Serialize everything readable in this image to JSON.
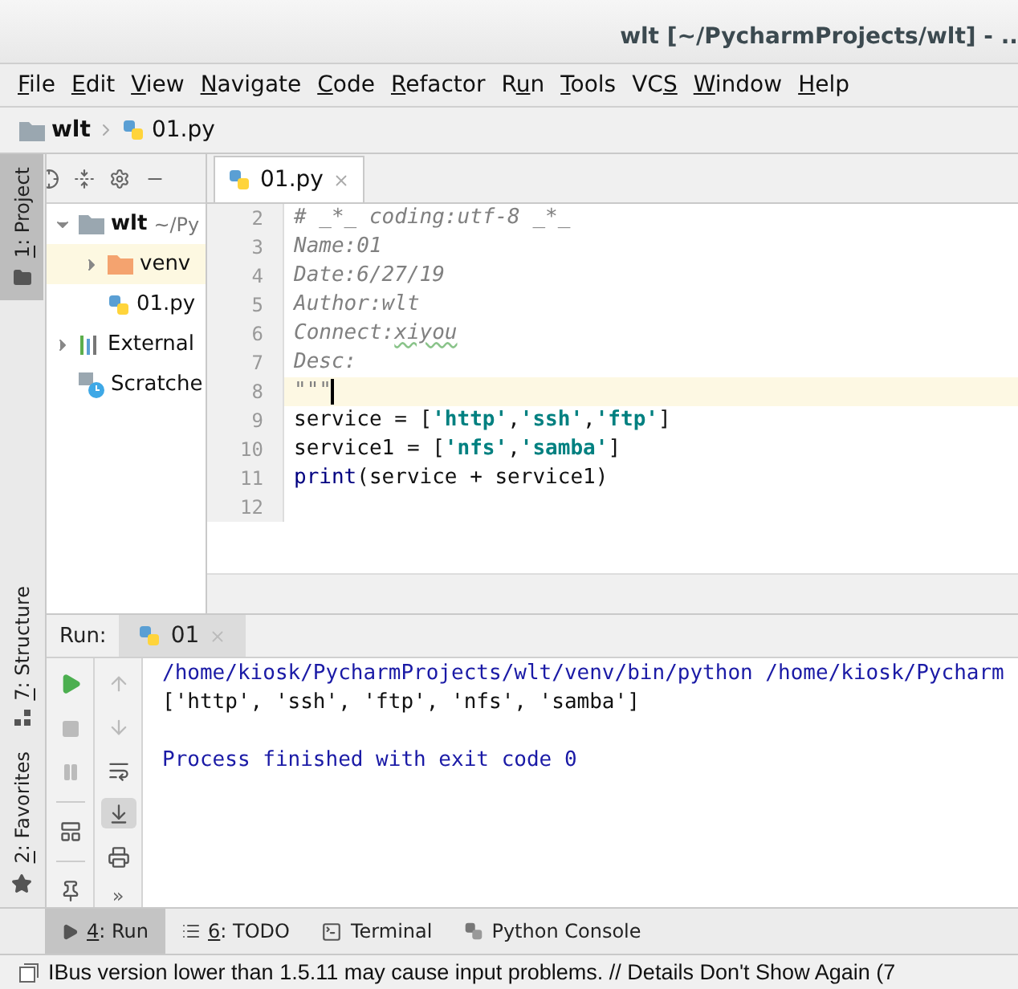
{
  "window": {
    "title": "wlt [~/PycharmProjects/wlt] - .."
  },
  "menu": [
    {
      "key": "F",
      "post": "ile"
    },
    {
      "key": "E",
      "post": "dit"
    },
    {
      "key": "V",
      "post": "iew"
    },
    {
      "key": "N",
      "post": "avigate"
    },
    {
      "key": "C",
      "post": "ode"
    },
    {
      "key": "R",
      "post": "efactor"
    },
    {
      "pre": "R",
      "key": "u",
      "post": "n"
    },
    {
      "key": "T",
      "post": "ools"
    },
    {
      "pre": "VC",
      "key": "S"
    },
    {
      "key": "W",
      "post": "indow"
    },
    {
      "key": "H",
      "post": "elp"
    }
  ],
  "breadcrumb": [
    {
      "kind": "folder",
      "label": "wlt"
    },
    {
      "kind": "python",
      "label": "01.py"
    }
  ],
  "left_tool_tabs": [
    {
      "key": "1",
      "post": ": Project",
      "selected": true,
      "kind": "folder"
    },
    {
      "key": "7",
      "post": ": Structure",
      "selected": false,
      "kind": "structure"
    },
    {
      "key": "2",
      "post": ": Favorites",
      "selected": false,
      "kind": "star"
    }
  ],
  "project_tree": [
    {
      "kind": "folder",
      "label": "wlt",
      "path": "~/Py",
      "expanded": true,
      "selected": false,
      "children": [
        {
          "kind": "venv",
          "label": "venv",
          "expanded": false,
          "selected": true
        },
        {
          "kind": "python",
          "label": "01.py",
          "selected": false
        }
      ]
    },
    {
      "kind": "library",
      "label": "External",
      "expanded": false,
      "selected": false
    },
    {
      "kind": "scratches",
      "label": "Scratche",
      "selected": false
    }
  ],
  "editor_tabs": [
    {
      "label": "01.py",
      "selected": true
    }
  ],
  "code_lines": [
    {
      "number": "2",
      "current": false,
      "tokens": [
        {
          "kind": "comment",
          "text": "# _*_ coding:utf-8 _*_"
        }
      ]
    },
    {
      "number": "3",
      "current": false,
      "tokens": [
        {
          "kind": "comment",
          "text": "Name:01"
        }
      ]
    },
    {
      "number": "4",
      "current": false,
      "tokens": [
        {
          "kind": "comment",
          "text": "Date:6/27/19"
        }
      ]
    },
    {
      "number": "5",
      "current": false,
      "tokens": [
        {
          "kind": "comment",
          "text": "Author:wlt"
        }
      ]
    },
    {
      "number": "6",
      "current": false,
      "tokens": [
        {
          "kind": "comment",
          "text": "Connect:"
        },
        {
          "kind": "typo",
          "text": "xiyou"
        }
      ]
    },
    {
      "number": "7",
      "current": false,
      "tokens": [
        {
          "kind": "comment",
          "text": "Desc:"
        }
      ]
    },
    {
      "number": "8",
      "current": true,
      "tokens": [
        {
          "kind": "comment",
          "text": "\"\"\""
        }
      ]
    },
    {
      "number": "9",
      "current": false,
      "tokens": [
        {
          "kind": "plain",
          "text": "service = ["
        },
        {
          "kind": "string",
          "text": "'http'"
        },
        {
          "kind": "plain",
          "text": ","
        },
        {
          "kind": "string",
          "text": "'ssh'"
        },
        {
          "kind": "plain",
          "text": ","
        },
        {
          "kind": "string",
          "text": "'ftp'"
        },
        {
          "kind": "plain",
          "text": "]"
        }
      ]
    },
    {
      "number": "10",
      "current": false,
      "tokens": [
        {
          "kind": "plain",
          "text": "service1 = ["
        },
        {
          "kind": "string",
          "text": "'nfs'"
        },
        {
          "kind": "plain",
          "text": ","
        },
        {
          "kind": "string",
          "text": "'samba'"
        },
        {
          "kind": "plain",
          "text": "]"
        }
      ]
    },
    {
      "number": "11",
      "current": false,
      "tokens": [
        {
          "kind": "builtin",
          "text": "print"
        },
        {
          "kind": "plain",
          "text": "(service + service1)"
        }
      ]
    },
    {
      "number": "12",
      "current": false
    }
  ],
  "run_panel": {
    "label": "Run:",
    "tabs": [
      {
        "label": "01",
        "selected": true
      }
    ],
    "console": [
      {
        "kind": "command",
        "text": "/home/kiosk/PycharmProjects/wlt/venv/bin/python /home/kiosk/Pycharm"
      },
      {
        "kind": "output",
        "text": "['http', 'ssh', 'ftp', 'nfs', 'samba']"
      },
      {
        "kind": "blank"
      },
      {
        "kind": "status",
        "text": "Process finished with exit code 0"
      }
    ],
    "more": "»"
  },
  "bottom_tabs": [
    {
      "kind": "run",
      "key": "4",
      "post": ": Run",
      "selected": true
    },
    {
      "kind": "todo",
      "key": "6",
      "post": ": TODO",
      "selected": false
    },
    {
      "kind": "terminal",
      "pre": "Terminal",
      "selected": false
    },
    {
      "kind": "python",
      "pre": "Python Console",
      "selected": false
    }
  ],
  "status_bar": {
    "message": "IBus version lower than 1.5.11 may cause input problems. // Details Don't Show Again (7"
  }
}
